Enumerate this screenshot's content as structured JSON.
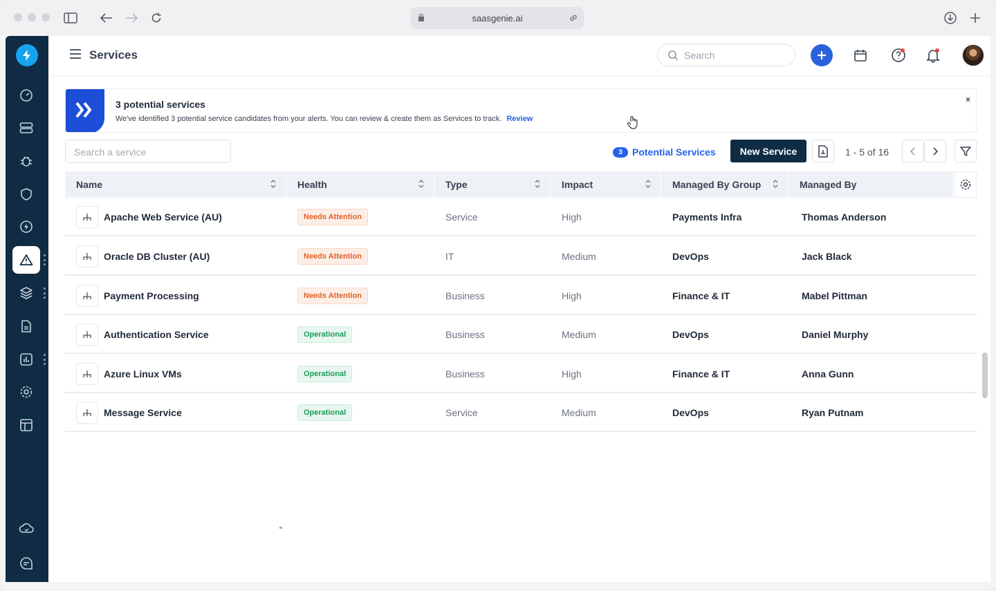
{
  "browser": {
    "url": "saasgenie.ai"
  },
  "header": {
    "title": "Services",
    "search_placeholder": "Search"
  },
  "sidebar": {
    "items": [
      {
        "name": "dashboard",
        "icon": "gauge-icon"
      },
      {
        "name": "servers",
        "icon": "server-icon"
      },
      {
        "name": "bugs",
        "icon": "bug-icon"
      },
      {
        "name": "security",
        "icon": "shield-icon"
      },
      {
        "name": "events",
        "icon": "bolt-circle-icon"
      },
      {
        "name": "services",
        "icon": "alert-triangle-icon",
        "active": true
      },
      {
        "name": "layers",
        "icon": "layers-icon"
      },
      {
        "name": "reports",
        "icon": "document-icon"
      },
      {
        "name": "analytics",
        "icon": "chart-icon"
      },
      {
        "name": "settings",
        "icon": "gear-icon"
      },
      {
        "name": "calendar",
        "icon": "table-icon"
      },
      {
        "name": "cloud",
        "icon": "cloud-icon"
      },
      {
        "name": "chat",
        "icon": "chat-icon"
      }
    ]
  },
  "banner": {
    "title": "3 potential services",
    "text": "We've identified 3 potential service candidates from your alerts. You can review & create them as Services to track.",
    "link": "Review",
    "close": "×"
  },
  "toolbar": {
    "search_placeholder": "Search a service",
    "potential_count": "3",
    "potential_label": "Potential Services",
    "new_service": "New Service",
    "pager": "1 - 5 of 16"
  },
  "table": {
    "columns": [
      "Name",
      "Health",
      "Type",
      "Impact",
      "Managed By Group",
      "Managed By"
    ],
    "rows": [
      {
        "name": "Apache Web Service (AU)",
        "health": "Needs Attention",
        "health_status": "warn",
        "type": "Service",
        "impact": "High",
        "group": "Payments Infra",
        "managed_by": "Thomas Anderson"
      },
      {
        "name": "Oracle DB Cluster (AU)",
        "health": "Needs Attention",
        "health_status": "warn",
        "type": "IT",
        "impact": "Medium",
        "group": "DevOps",
        "managed_by": "Jack Black"
      },
      {
        "name": "Payment Processing",
        "health": "Needs Attention",
        "health_status": "warn",
        "type": "Business",
        "impact": "High",
        "group": "Finance & IT",
        "managed_by": "Mabel Pittman"
      },
      {
        "name": "Authentication Service",
        "health": "Operational",
        "health_status": "ok",
        "type": "Business",
        "impact": "Medium",
        "group": "DevOps",
        "managed_by": "Daniel Murphy"
      },
      {
        "name": "Azure Linux VMs",
        "health": "Operational",
        "health_status": "ok",
        "type": "Business",
        "impact": "High",
        "group": "Finance & IT",
        "managed_by": "Anna Gunn"
      },
      {
        "name": "Message Service",
        "health": "Operational",
        "health_status": "ok",
        "type": "Service",
        "impact": "Medium",
        "group": "DevOps",
        "managed_by": "Ryan Putnam"
      }
    ]
  },
  "colors": {
    "sidebar_bg": "#0f2c44",
    "accent": "#2563eb",
    "warn": "#e0612b",
    "ok": "#1c9a5a"
  }
}
